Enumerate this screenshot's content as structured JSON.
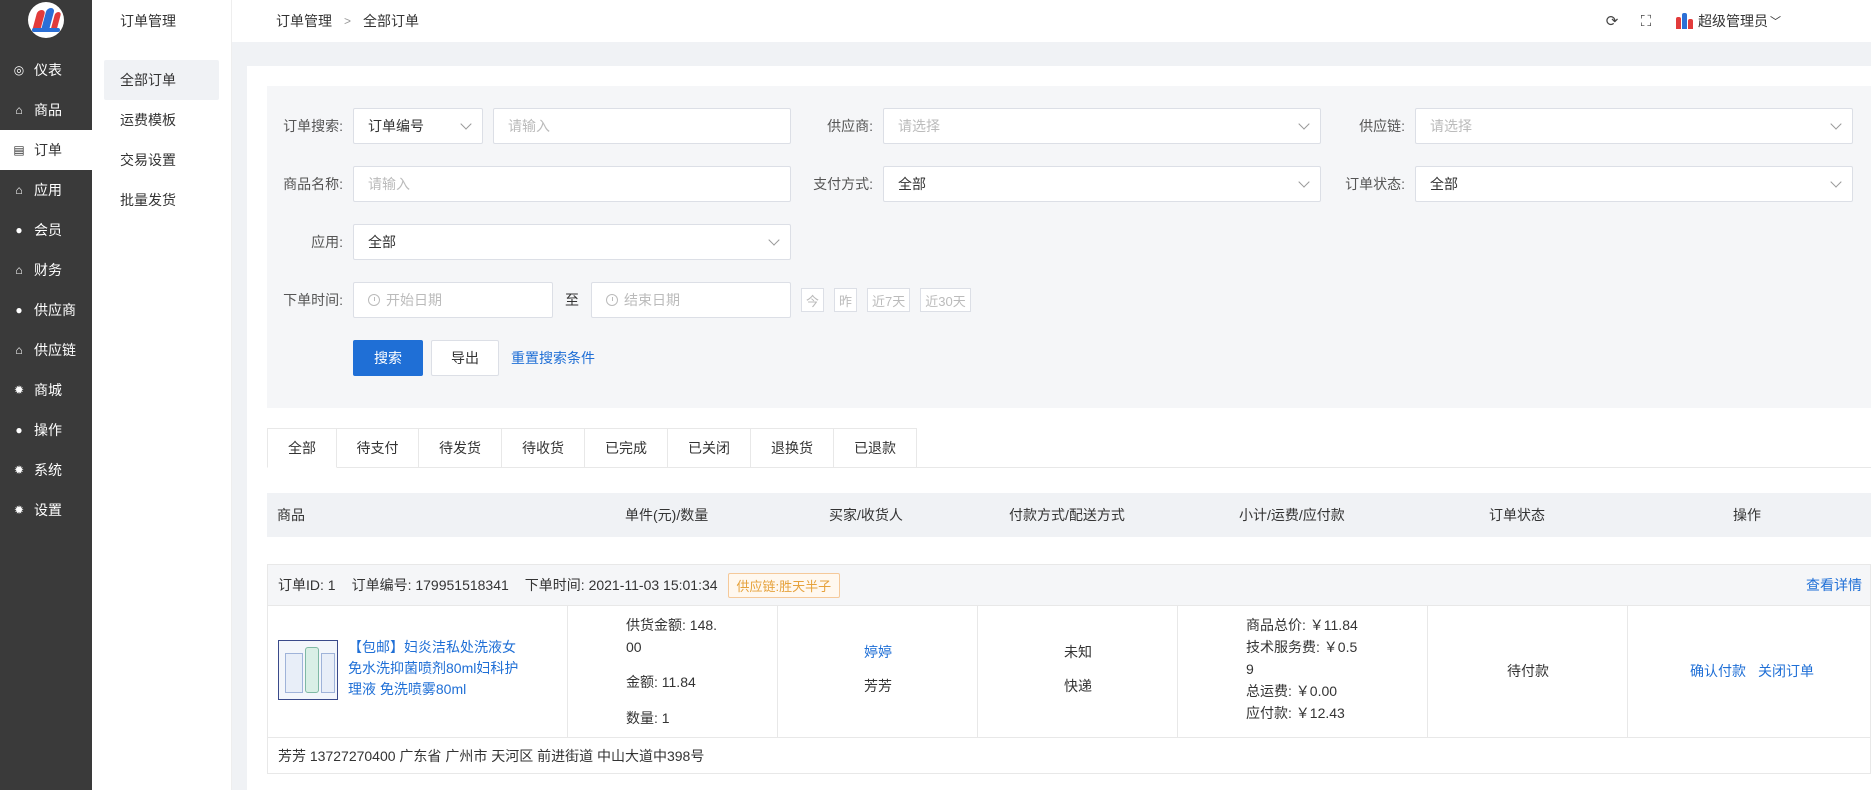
{
  "nav": {
    "items": [
      {
        "label": "仪表",
        "icon": "dashboard-icon"
      },
      {
        "label": "商品",
        "icon": "bag-icon"
      },
      {
        "label": "订单",
        "icon": "document-icon"
      },
      {
        "label": "应用",
        "icon": "bag-icon"
      },
      {
        "label": "会员",
        "icon": "user-icon"
      },
      {
        "label": "财务",
        "icon": "bag-icon"
      },
      {
        "label": "供应商",
        "icon": "user-icon"
      },
      {
        "label": "供应链",
        "icon": "bag-icon"
      },
      {
        "label": "商城",
        "icon": "gear-icon"
      },
      {
        "label": "操作",
        "icon": "user-icon"
      },
      {
        "label": "系统",
        "icon": "gear-icon"
      },
      {
        "label": "设置",
        "icon": "gear-icon"
      }
    ],
    "active_index": 2
  },
  "sub_nav": {
    "title": "订单管理",
    "items": [
      "全部订单",
      "运费模板",
      "交易设置",
      "批量发货"
    ]
  },
  "header": {
    "breadcrumb": [
      "订单管理",
      "全部订单"
    ],
    "user": "超级管理员"
  },
  "search": {
    "order_search_label": "订单搜索:",
    "order_search_type": "订单编号",
    "order_search_placeholder": "请输入",
    "supplier_label": "供应商:",
    "supplier_placeholder": "请选择",
    "supply_chain_label": "供应链:",
    "supply_chain_placeholder": "请选择",
    "product_name_label": "商品名称:",
    "product_name_placeholder": "请输入",
    "pay_method_label": "支付方式:",
    "pay_method_value": "全部",
    "order_status_label": "订单状态:",
    "order_status_value": "全部",
    "app_label": "应用:",
    "app_value": "全部",
    "order_time_label": "下单时间:",
    "start_date_placeholder": "开始日期",
    "date_to": "至",
    "end_date_placeholder": "结束日期",
    "quick_dates": [
      "今",
      "昨",
      "近7天",
      "近30天"
    ],
    "search_button": "搜索",
    "export_button": "导出",
    "reset_link": "重置搜索条件"
  },
  "tabs": [
    "全部",
    "待支付",
    "待发货",
    "待收货",
    "已完成",
    "已关闭",
    "退换货",
    "已退款"
  ],
  "table_headers": [
    "商品",
    "单件(元)/数量",
    "买家/收货人",
    "付款方式/配送方式",
    "小计/运费/应付款",
    "订单状态",
    "操作"
  ],
  "order": {
    "id_text": "订单ID: 1",
    "number_text": "订单编号: 179951518341",
    "time_text": "下单时间: 2021-11-03 15:01:34",
    "supply_tag": "供应链:胜天半子",
    "detail_link": "查看详情",
    "product_name": "【包邮】妇炎洁私处洗液女免水洗抑菌喷剂80ml妇科护理液 免洗喷雾80ml",
    "supply_amount_line1": "供货金额: 148.",
    "supply_amount_line2": "00",
    "amount": "金额: 11.84",
    "quantity": "数量: 1",
    "buyer": "婷婷",
    "receiver": "芳芳",
    "pay_method": "未知",
    "delivery": "快递",
    "goods_total": "商品总价: ￥11.84",
    "service_fee_line1": "技术服务费: ￥0.5",
    "service_fee_line2": "9",
    "freight": "总运费: ￥0.00",
    "payable": "应付款: ￥12.43",
    "status": "待付款",
    "action_confirm": "确认付款",
    "action_close": "关闭订单",
    "address": "芳芳 13727270400 广东省 广州市 天河区 前进街道 中山大道中398号"
  },
  "colors": {
    "primary": "#1f6fd6",
    "nav_bg": "#3a3a3a",
    "tag": "#e6a23c"
  }
}
